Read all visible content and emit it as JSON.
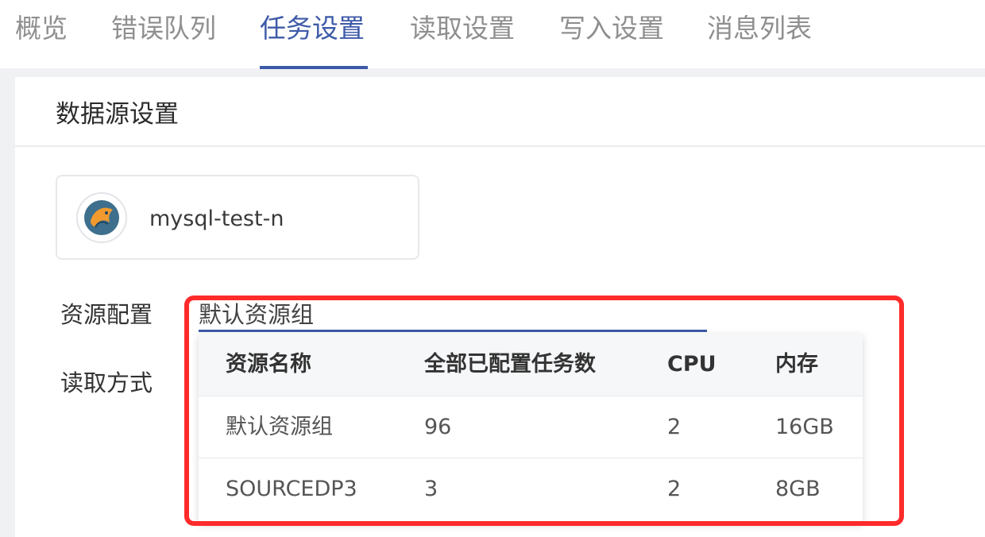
{
  "tabs": [
    {
      "label": "概览"
    },
    {
      "label": "错误队列"
    },
    {
      "label": "任务设置",
      "active": true
    },
    {
      "label": "读取设置"
    },
    {
      "label": "写入设置"
    },
    {
      "label": "消息列表"
    }
  ],
  "section": {
    "title": "数据源设置"
  },
  "datasource": {
    "name": "mysql-test-n",
    "icon": "mysql-dolphin-icon"
  },
  "form": {
    "resource_label": "资源配置",
    "resource_value": "默认资源组",
    "read_label": "读取方式"
  },
  "resource_table": {
    "columns": [
      "资源名称",
      "全部已配置任务数",
      "CPU",
      "内存"
    ],
    "rows": [
      [
        "默认资源组",
        "96",
        "2",
        "16GB"
      ],
      [
        "SOURCEDP3",
        "3",
        "2",
        "8GB"
      ]
    ]
  },
  "colors": {
    "accent": "#3d5aa8",
    "highlight": "#ff2b2b"
  }
}
